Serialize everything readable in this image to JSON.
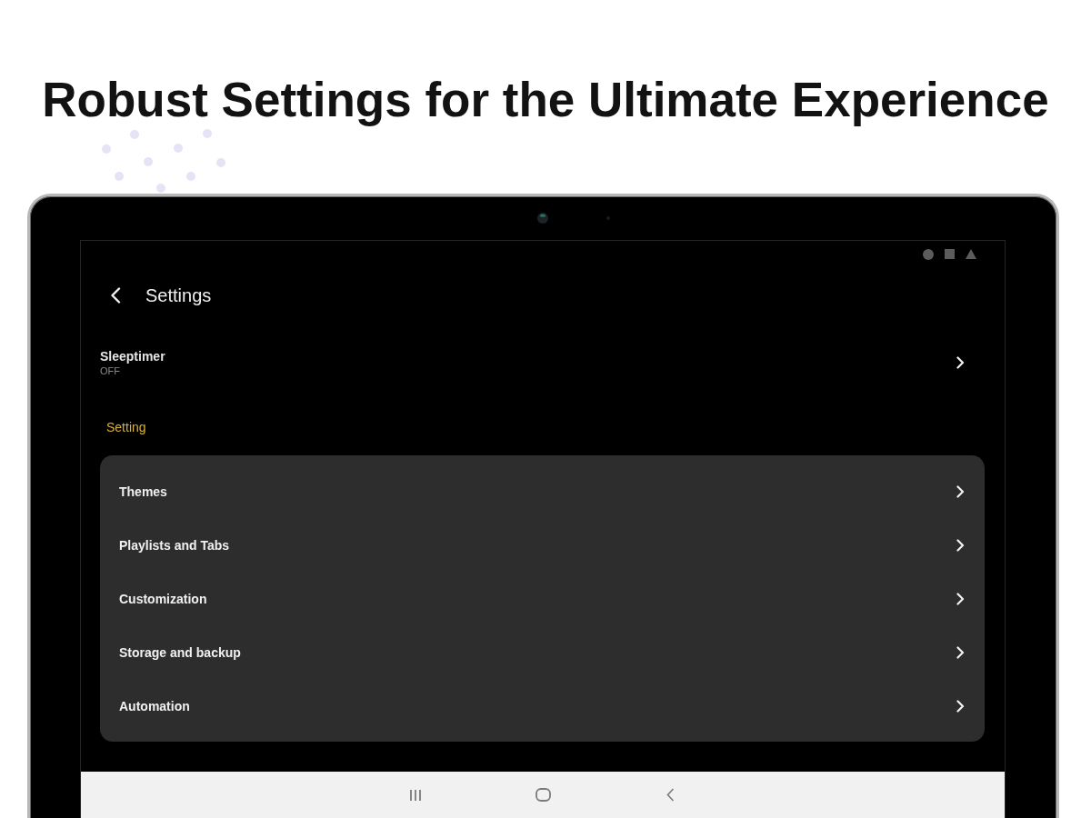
{
  "headline": "Robust Settings for the Ultimate Experience",
  "app_bar": {
    "title": "Settings"
  },
  "sleeptimer": {
    "title": "Sleeptimer",
    "value": "OFF"
  },
  "section": {
    "label": "Setting"
  },
  "menu_items": [
    {
      "label": "Themes"
    },
    {
      "label": "Playlists and Tabs"
    },
    {
      "label": "Customization"
    },
    {
      "label": "Storage and backup"
    },
    {
      "label": "Automation"
    }
  ]
}
